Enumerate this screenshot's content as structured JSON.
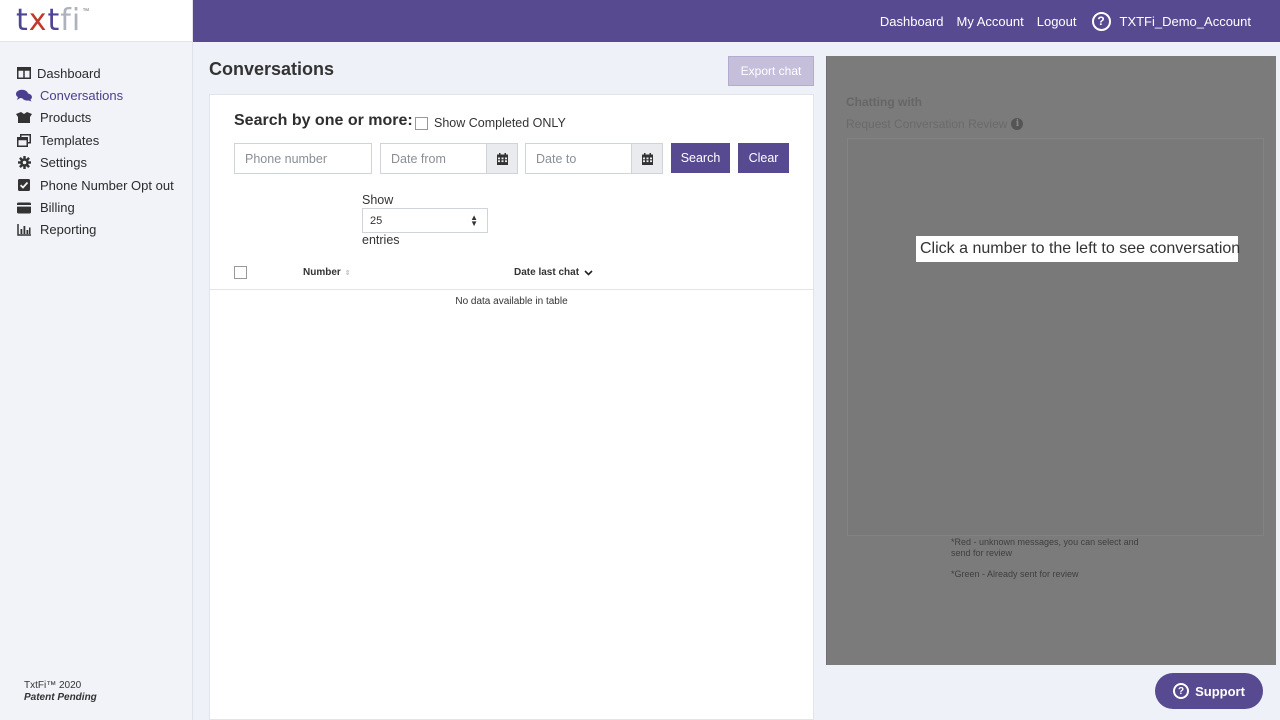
{
  "logo": {
    "letters": [
      "t",
      "x",
      "t",
      "fi"
    ],
    "tm": "™"
  },
  "sidebar": {
    "items": [
      {
        "label": "Dashboard",
        "icon": "table-columns-icon",
        "active": false
      },
      {
        "label": "Conversations",
        "icon": "comments-icon",
        "active": true
      },
      {
        "label": "Products",
        "icon": "boxes-icon",
        "active": false
      },
      {
        "label": "Templates",
        "icon": "window-restore-icon",
        "active": false
      },
      {
        "label": "Settings",
        "icon": "gear-icon",
        "active": false
      },
      {
        "label": "Phone Number Opt out",
        "icon": "check-square-icon",
        "active": false
      },
      {
        "label": "Billing",
        "icon": "wallet-icon",
        "active": false
      },
      {
        "label": "Reporting",
        "icon": "bar-chart-icon",
        "active": false
      }
    ],
    "footer": {
      "copyright": "TxtFi™ 2020",
      "patent": "Patent Pending"
    }
  },
  "topbar": {
    "links": [
      "Dashboard",
      "My Account",
      "Logout"
    ],
    "help_glyph": "?",
    "account": "TXTFi_Demo_Account"
  },
  "main": {
    "title": "Conversations",
    "export_label": "Export chat",
    "search": {
      "label": "Search by one or more:",
      "completed_label": "Show Completed ONLY",
      "phone_placeholder": "Phone number",
      "date_from_placeholder": "Date from",
      "date_to_placeholder": "Date to",
      "search_label": "Search",
      "clear_label": "Clear"
    },
    "length": {
      "show": "Show",
      "value": "25",
      "entries": "entries"
    },
    "table": {
      "columns": [
        "Number",
        "Date last chat"
      ],
      "empty": "No data available in table"
    }
  },
  "chat_panel": {
    "chatting_with": "Chatting with",
    "review_label": "Request Conversation Review",
    "info_glyph": "i",
    "hint": "Click a number to the left to see conversation",
    "note_red": "*Red - unknown messages, you can select and send for review",
    "note_green": "*Green - Already sent for review"
  },
  "support": {
    "label": "Support",
    "glyph": "?"
  },
  "colors": {
    "brand": "#574a91",
    "logo_x": "#c0392b",
    "overlay": "#7b7b7b"
  }
}
